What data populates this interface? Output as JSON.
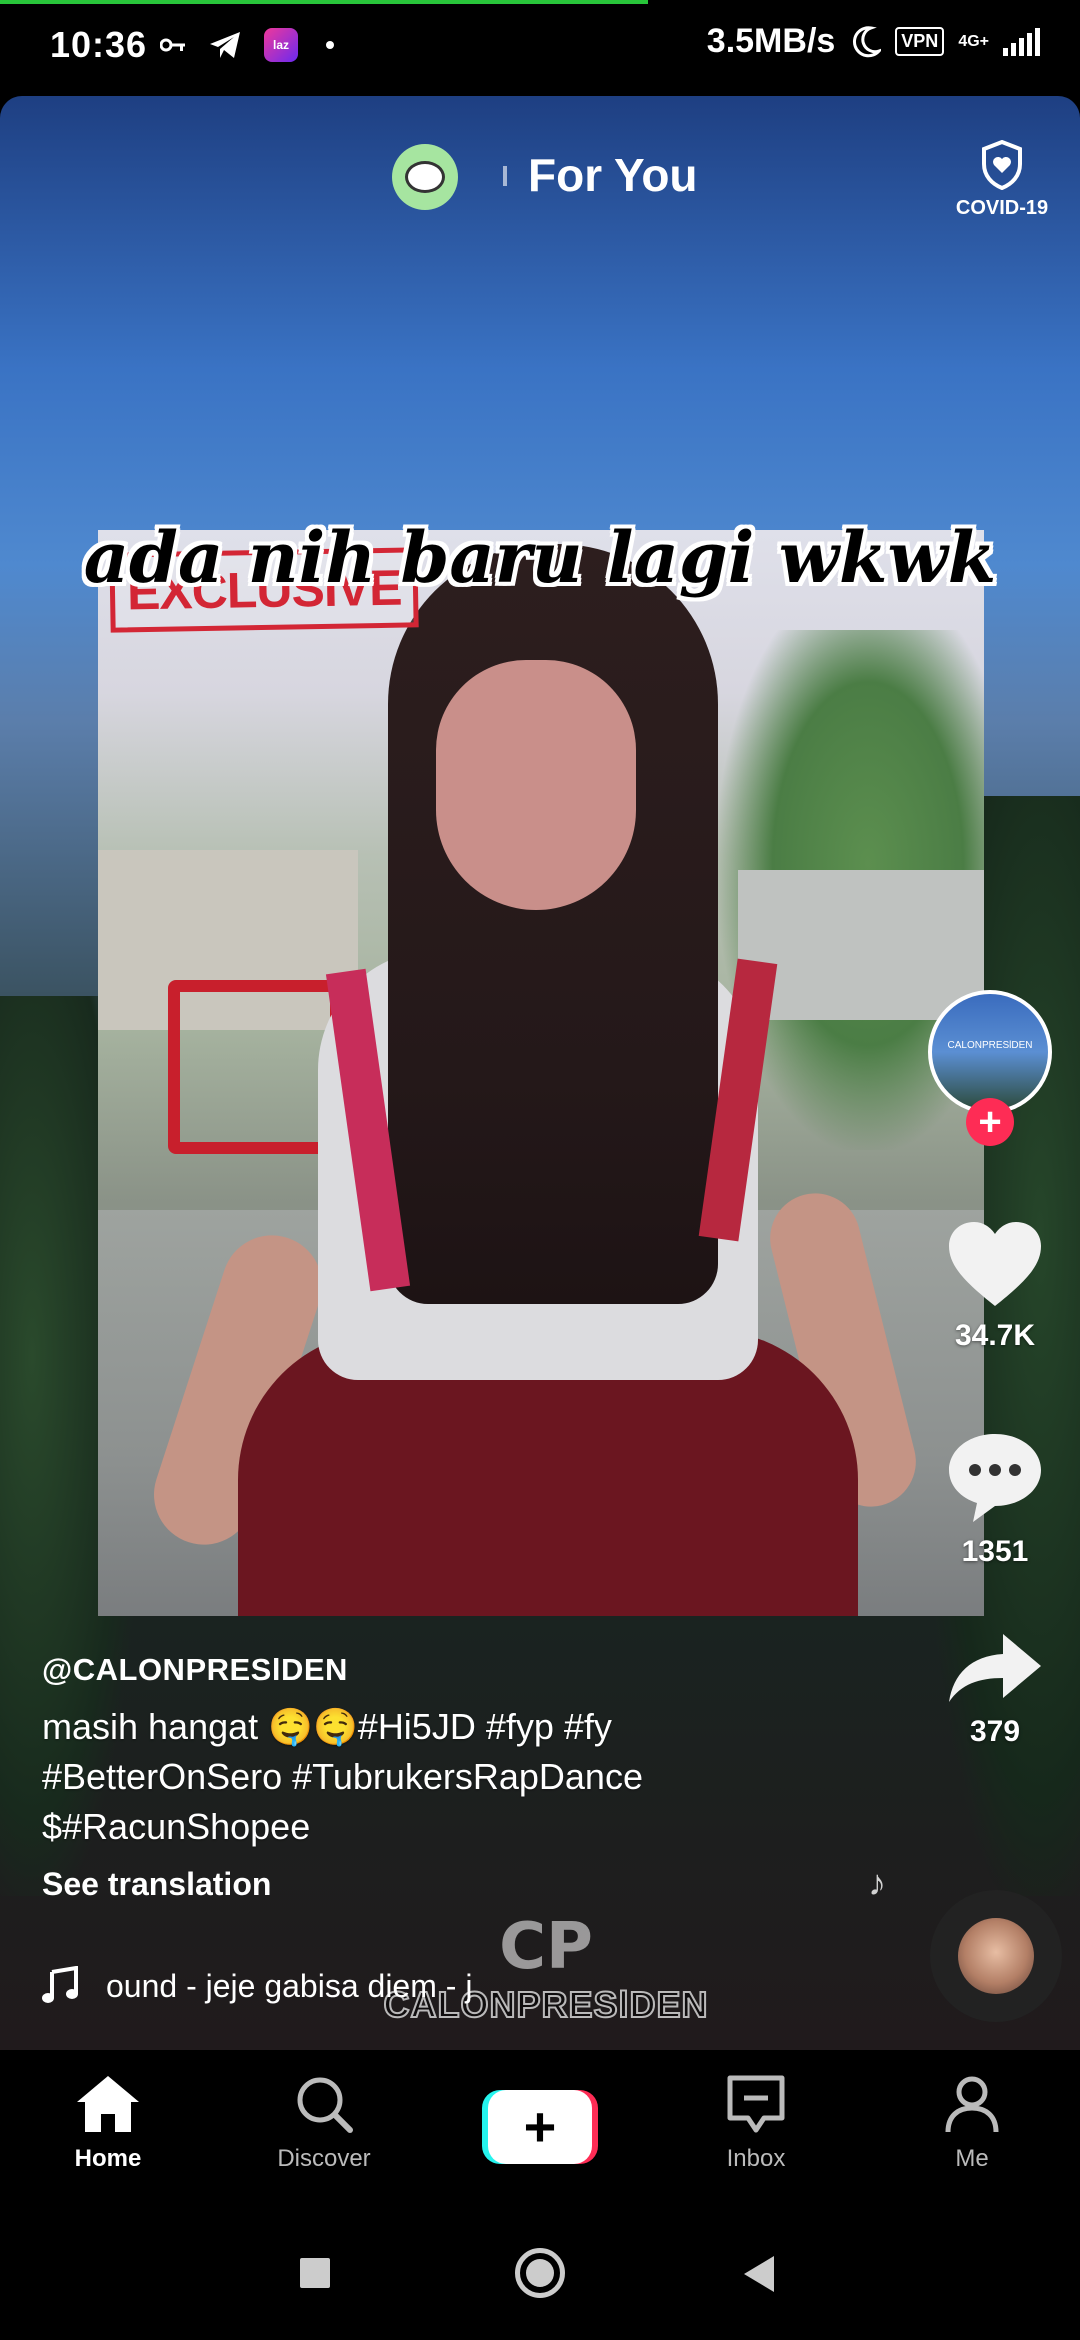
{
  "status_bar": {
    "time": "10:36",
    "network_speed": "3.5MB/s",
    "vpn": "VPN",
    "signal": "4G+"
  },
  "top_nav": {
    "feed_title": "For You",
    "covid_label": "COVID-19"
  },
  "video": {
    "overlay_text": "ada nih baru lagi wkwk",
    "stamp_text": "EXCLUSIVE",
    "watermark_logo": "CP",
    "watermark_text": "CALONPRESlDEN"
  },
  "creator": {
    "avatar_text": "CALONPRESlDEN"
  },
  "actions": {
    "likes": "34.7K",
    "comments": "1351",
    "shares": "379"
  },
  "caption": {
    "username": "@CALONPRESlDEN",
    "line1": "masih hangat 🤤🤤#Hi5JD #fyp #fy",
    "line2": "#BetterOnSero #TubrukersRapDance",
    "line3": "$#RacunShopee",
    "see_translation": "See translation",
    "sound": "ound - jeje gabisa diem - j"
  },
  "bottom_nav": {
    "tabs": [
      {
        "label": "Home",
        "icon": "home-icon"
      },
      {
        "label": "Discover",
        "icon": "search-icon"
      },
      {
        "label": "Inbox",
        "icon": "inbox-icon"
      },
      {
        "label": "Me",
        "icon": "profile-icon"
      }
    ],
    "create_icon": "plus-icon"
  },
  "colors": {
    "accent": "#fe2c55",
    "cyan": "#25f4ee",
    "loading_bar": "#28c53a"
  }
}
